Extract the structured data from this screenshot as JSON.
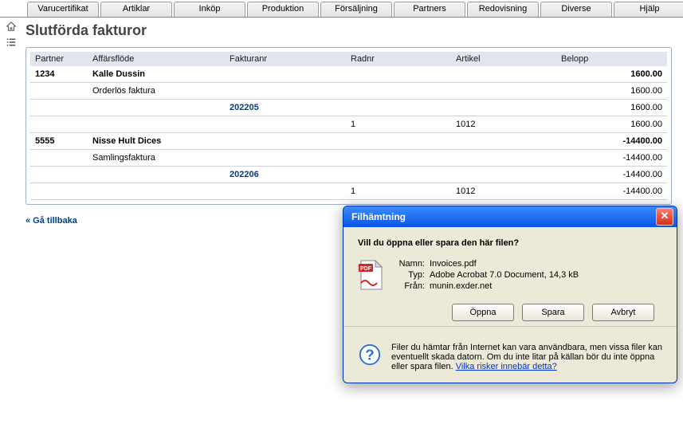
{
  "tabs": [
    "Varucertifikat",
    "Artiklar",
    "Inköp",
    "Produktion",
    "Försäljning",
    "Partners",
    "Redovisning",
    "Diverse",
    "Hjälp"
  ],
  "page": {
    "title": "Slutförda fakturor",
    "back_link": "« Gå tillbaka"
  },
  "table": {
    "headers": {
      "partner": "Partner",
      "flow": "Affärsflöde",
      "invoice": "Fakturanr",
      "row": "Radnr",
      "article": "Artikel",
      "amount": "Belopp"
    },
    "rows": [
      {
        "kind": "group",
        "partner": "1234",
        "name": "Kalle Dussin",
        "amount": "1600.00"
      },
      {
        "kind": "flow",
        "flow": "Orderlös faktura",
        "amount": "1600.00"
      },
      {
        "kind": "invoice",
        "invoice": "202205",
        "amount": "1600.00"
      },
      {
        "kind": "line",
        "row": "1",
        "article": "1012",
        "amount": "1600.00"
      },
      {
        "kind": "group",
        "partner": "5555",
        "name": "Nisse Hult Dices",
        "amount": "-14400.00"
      },
      {
        "kind": "flow",
        "flow": "Samlingsfaktura",
        "amount": "-14400.00"
      },
      {
        "kind": "invoice",
        "invoice": "202206",
        "amount": "-14400.00"
      },
      {
        "kind": "line",
        "row": "1",
        "article": "1012",
        "amount": "-14400.00"
      }
    ]
  },
  "dialog": {
    "title": "Filhämtning",
    "question": "Vill du öppna eller spara den här filen?",
    "name_label": "Namn:",
    "name_value": "Invoices.pdf",
    "type_label": "Typ:",
    "type_value": "Adobe Acrobat 7.0 Document, 14,3 kB",
    "from_label": "Från:",
    "from_value": "munin.exder.net",
    "open_btn": "Öppna",
    "save_btn": "Spara",
    "cancel_btn": "Avbryt",
    "footer_text": "Filer du hämtar från Internet kan vara användbara, men vissa filer kan eventuellt skada datorn. Om du inte litar på källan bör du inte öppna eller spara filen. ",
    "footer_link": "Vilka risker innebär detta?"
  }
}
